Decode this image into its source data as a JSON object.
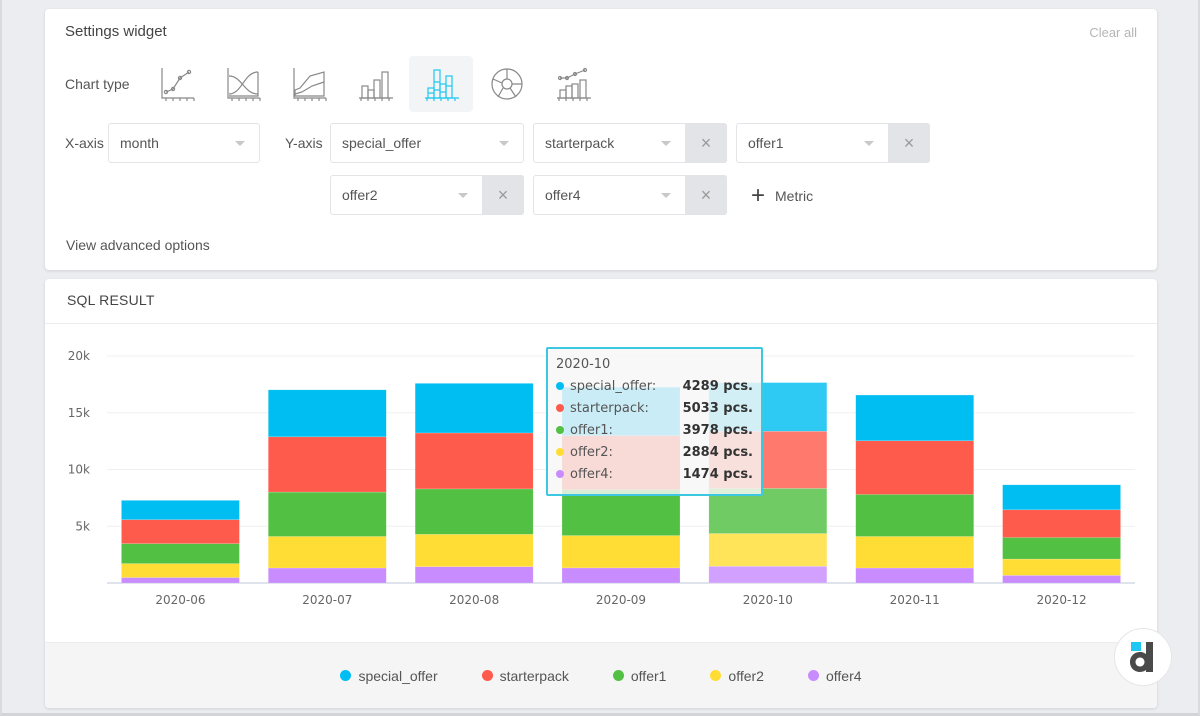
{
  "settings": {
    "title": "Settings widget",
    "clear_all": "Clear all",
    "chart_type_label": "Chart type",
    "chart_types": [
      {
        "name": "line-chart-icon",
        "active": false
      },
      {
        "name": "area-crossing-chart-icon",
        "active": false
      },
      {
        "name": "area-chart-icon",
        "active": false
      },
      {
        "name": "bar-chart-icon",
        "active": false
      },
      {
        "name": "stacked-bar-chart-icon",
        "active": true
      },
      {
        "name": "pie-chart-icon",
        "active": false
      },
      {
        "name": "combo-chart-icon",
        "active": false
      }
    ],
    "x_axis_label": "X-axis",
    "x_axis_value": "month",
    "y_axis_label": "Y-axis",
    "y_metrics": [
      "special_offer",
      "starterpack",
      "offer1",
      "offer2",
      "offer4"
    ],
    "add_metric_label": "Metric",
    "advanced_options": "View advanced options"
  },
  "result": {
    "title": "SQL RESULT"
  },
  "tooltip": {
    "title": "2020-10",
    "rows": [
      {
        "name": "special_offer:",
        "value": "4289 pcs.",
        "color": "#00bef2"
      },
      {
        "name": "starterpack:",
        "value": "5033 pcs.",
        "color": "#ff5b4c"
      },
      {
        "name": "offer1:",
        "value": "3978 pcs.",
        "color": "#52c042"
      },
      {
        "name": "offer2:",
        "value": "2884 pcs.",
        "color": "#ffdd35"
      },
      {
        "name": "offer4:",
        "value": "1474 pcs.",
        "color": "#c88cff"
      }
    ]
  },
  "chart_data": {
    "type": "bar",
    "stacked": true,
    "title": "",
    "xlabel": "",
    "ylabel": "",
    "ylim": [
      0,
      20000
    ],
    "yticks": [
      0,
      5000,
      10000,
      15000,
      20000
    ],
    "ytick_labels": [
      "",
      "5k",
      "10k",
      "15k",
      "20k"
    ],
    "grid": true,
    "legend_position": "bottom",
    "categories": [
      "2020-06",
      "2020-07",
      "2020-08",
      "2020-09",
      "2020-10",
      "2020-11",
      "2020-12"
    ],
    "highlighted_category": "2020-10",
    "series": [
      {
        "name": "offer4",
        "color": "#c88cff",
        "values": [
          480,
          1320,
          1440,
          1330,
          1474,
          1320,
          670
        ]
      },
      {
        "name": "offer2",
        "color": "#ffdd35",
        "values": [
          1230,
          2780,
          2850,
          2850,
          2884,
          2780,
          1440
        ]
      },
      {
        "name": "offer1",
        "color": "#52c042",
        "values": [
          1760,
          3910,
          4000,
          4050,
          3978,
          3700,
          1900
        ]
      },
      {
        "name": "starterpack",
        "color": "#ff5b4c",
        "values": [
          2110,
          4870,
          4930,
          4760,
          5033,
          4730,
          2440
        ]
      },
      {
        "name": "special_offer",
        "color": "#00bef2",
        "values": [
          1700,
          4140,
          4370,
          4260,
          4289,
          4030,
          2200
        ]
      }
    ],
    "legend": [
      "special_offer",
      "starterpack",
      "offer1",
      "offer2",
      "offer4"
    ]
  }
}
